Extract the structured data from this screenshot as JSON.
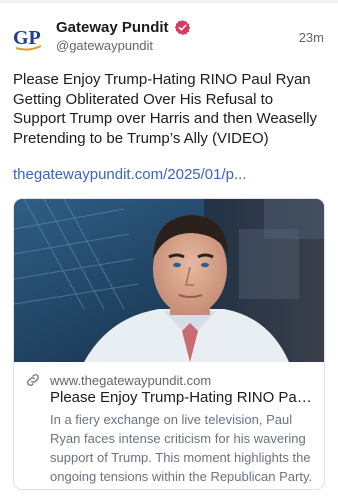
{
  "post": {
    "author": {
      "avatar_text": "GP",
      "display_name": "Gateway Pundit",
      "handle": "@gatewaypundit",
      "verified": true,
      "verified_color": "#d9395e"
    },
    "timestamp": "23m",
    "text": "Please Enjoy Trump-Hating RINO Paul Ryan Getting Obliterated Over His Refusal to Support Trump over Harris and then Weaselly Pretending to be Trump’s Ally (VIDEO)",
    "link_text": "thegatewaypundit.com/2025/01/p...",
    "link_color": "#3b64c0",
    "card": {
      "domain": "www.thegatewaypundit.com",
      "title": "Please Enjoy Trump-Hating RINO Paul Ryan Getting Obliterated Over His Refusal to Support Trump",
      "description": "In a fiery exchange on live television, Paul Ryan faces intense criticism for his wavering support of Trump. This moment highlights the ongoing tensions within the Republican Party."
    }
  }
}
